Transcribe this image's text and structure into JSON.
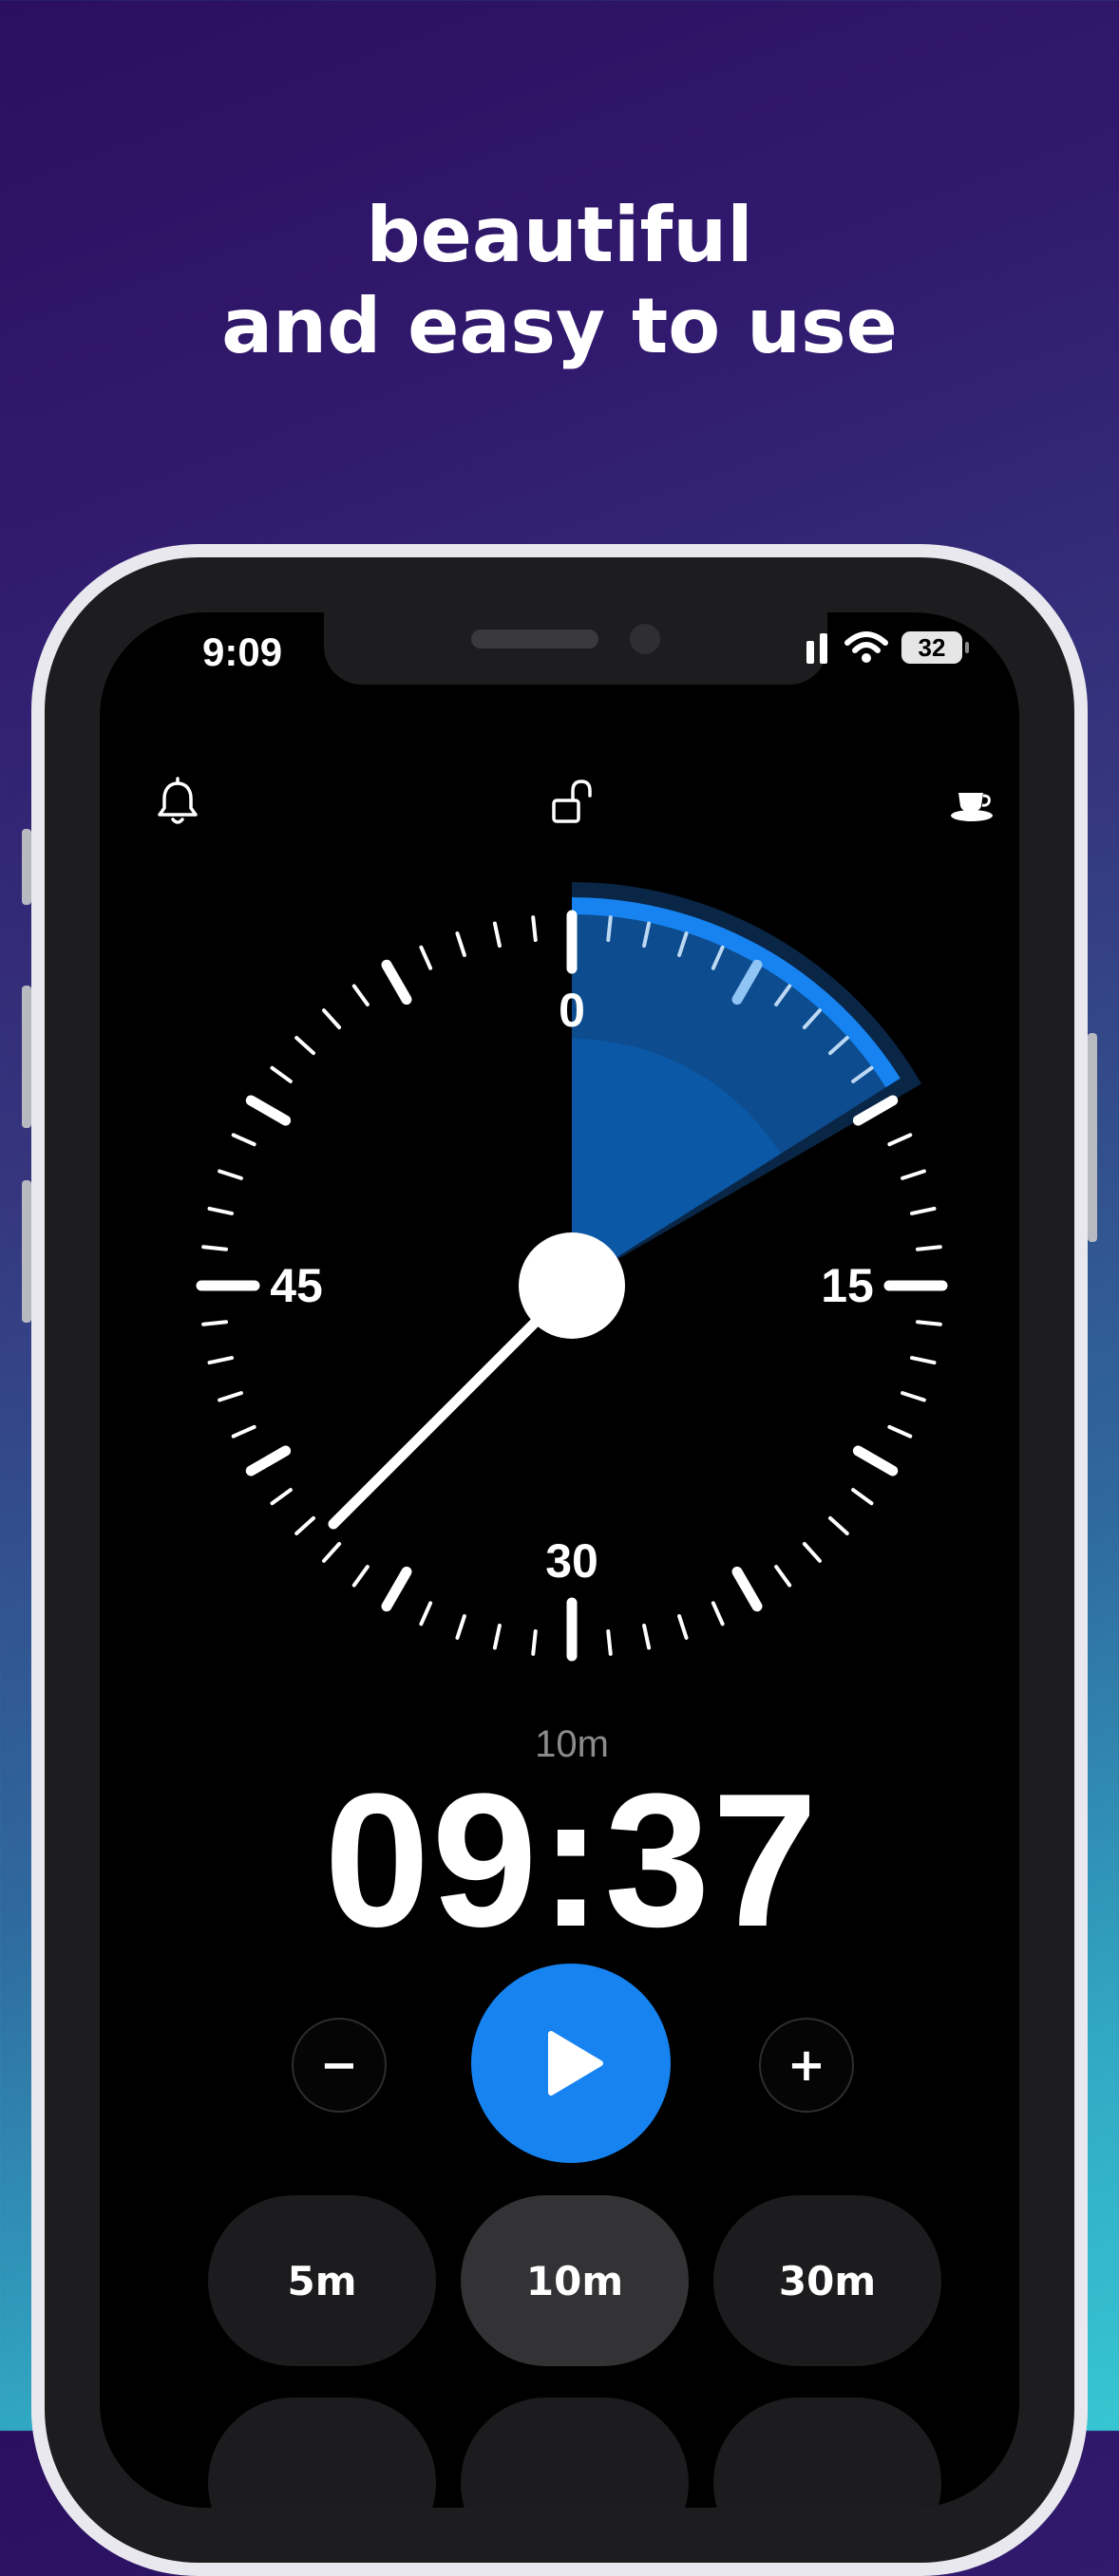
{
  "headline": {
    "line1": "beautiful",
    "line2": "and easy to use"
  },
  "status_bar": {
    "time": "9:09",
    "battery": "32"
  },
  "icons": {
    "left": "bell-icon",
    "center": "unlocked-padlock-icon",
    "right": "coffee-cup-icon"
  },
  "dial": {
    "minute_labels": [
      "0",
      "15",
      "30",
      "45"
    ],
    "set_minutes": 10,
    "remaining_minutes": 9.62,
    "accent_color": "#1683f0"
  },
  "timer": {
    "label": "10m",
    "display": "09:37",
    "decrement_label": "−",
    "increment_label": "+"
  },
  "presets": [
    {
      "label": "5m",
      "selected": false
    },
    {
      "label": "10m",
      "selected": true
    },
    {
      "label": "30m",
      "selected": false
    }
  ]
}
